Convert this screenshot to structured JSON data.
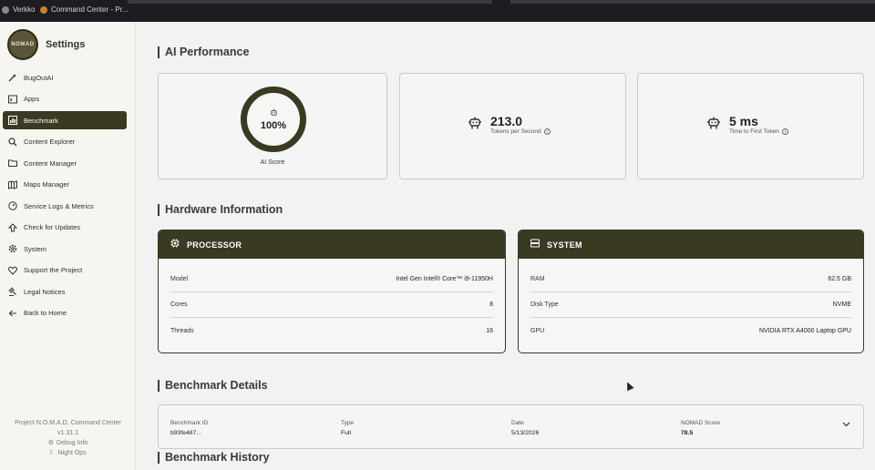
{
  "topbar": {
    "tab1": "Verkko",
    "tab2": "Command Center - Pr..."
  },
  "sidebar": {
    "title": "Settings",
    "logo_text": "NOMAD",
    "items": [
      {
        "label": "BugOutAI",
        "icon": "wand-icon"
      },
      {
        "label": "Apps",
        "icon": "terminal-icon"
      },
      {
        "label": "Benchmark",
        "icon": "chart-icon"
      },
      {
        "label": "Content Explorer",
        "icon": "search-icon"
      },
      {
        "label": "Content Manager",
        "icon": "folder-icon"
      },
      {
        "label": "Maps Manager",
        "icon": "map-icon"
      },
      {
        "label": "Service Logs & Metrics",
        "icon": "gauge-icon"
      },
      {
        "label": "Check for Updates",
        "icon": "update-icon"
      },
      {
        "label": "System",
        "icon": "gear-icon"
      },
      {
        "label": "Support the Project",
        "icon": "heart-icon"
      },
      {
        "label": "Legal Notices",
        "icon": "gavel-icon"
      },
      {
        "label": "Back to Home",
        "icon": "arrow-left-icon"
      }
    ],
    "footer": {
      "project": "Project N.O.M.A.D. Command Center",
      "version": "v1.31.1",
      "debug": "Debug Info",
      "night": "Night Ops"
    }
  },
  "sections": {
    "ai_performance": "AI Performance",
    "hardware": "Hardware Information",
    "benchmark_details": "Benchmark Details",
    "benchmark_history": "Benchmark History"
  },
  "performance": {
    "ai_score_value": "100%",
    "ai_score_label": "AI Score",
    "tokens_value": "213.0",
    "tokens_label": "Tokens per Second",
    "ttft_value": "5 ms",
    "ttft_label": "Time to First Token",
    "ai_score_fraction": 1.0
  },
  "processor": {
    "title": "PROCESSOR",
    "rows": [
      {
        "label": "Model",
        "value": "Intel Gen Intel® Core™ i9-11950H"
      },
      {
        "label": "Cores",
        "value": "8"
      },
      {
        "label": "Threads",
        "value": "16"
      }
    ]
  },
  "system": {
    "title": "SYSTEM",
    "rows": [
      {
        "label": "RAM",
        "value": "62.5 GB"
      },
      {
        "label": "Disk Type",
        "value": "NVME"
      },
      {
        "label": "GPU",
        "value": "NVIDIA RTX A4000 Laptop GPU"
      }
    ]
  },
  "benchmark": {
    "id_label": "Benchmark ID",
    "id_value": "b93fe487...",
    "type_label": "Type",
    "type_value": "Full",
    "date_label": "Date",
    "date_value": "5/13/2026",
    "score_label": "NOMAD Score",
    "score_value": "78.5"
  },
  "colors": {
    "accent": "#3a3922",
    "background": "#f1f2f2",
    "sidebar": "#f6f5ef"
  }
}
